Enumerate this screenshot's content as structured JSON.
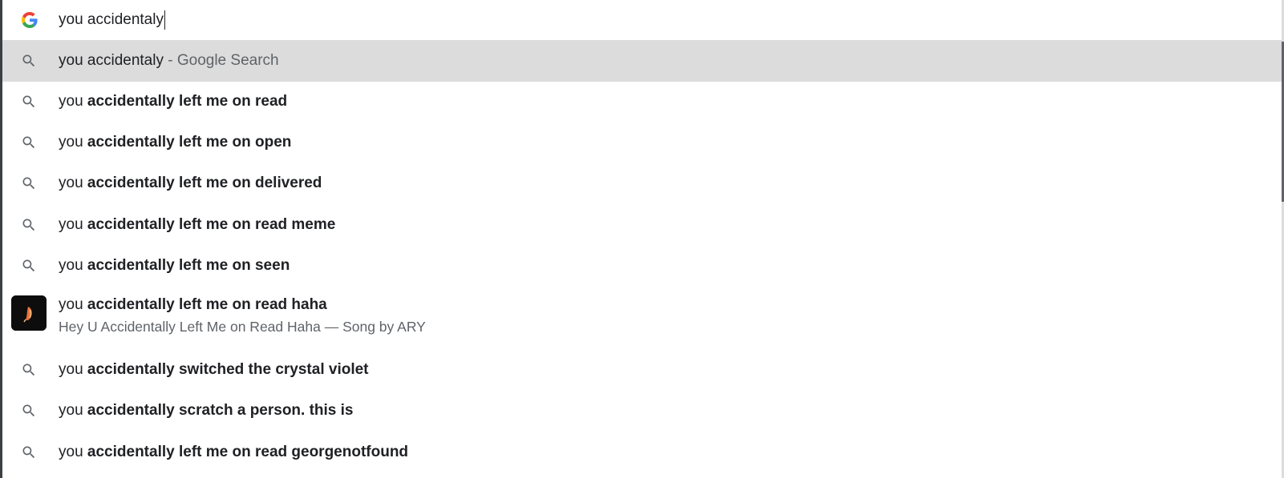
{
  "omnibox": {
    "query": "you accidentaly",
    "engine_icon": "google-g-icon"
  },
  "suggestions": [
    {
      "prefix": "you accidentaly",
      "bold": "",
      "sep": " - ",
      "tail": "Google Search",
      "icon": "search-icon",
      "selected": true
    },
    {
      "prefix": "you ",
      "bold": "accidentally left me on read",
      "icon": "search-icon"
    },
    {
      "prefix": "you ",
      "bold": "accidentally left me on open",
      "icon": "search-icon"
    },
    {
      "prefix": "you ",
      "bold": "accidentally left me on delivered",
      "icon": "search-icon"
    },
    {
      "prefix": "you ",
      "bold": "accidentally left me on read meme",
      "icon": "search-icon"
    },
    {
      "prefix": "you ",
      "bold": "accidentally left me on seen",
      "icon": "search-icon"
    },
    {
      "prefix": "you ",
      "bold": "accidentally left me on read haha",
      "subtitle": "Hey U Accidentally Left Me on Read Haha — Song by ARY",
      "icon": "album-art-thumbnail"
    },
    {
      "prefix": "you ",
      "bold": "accidentally switched the crystal violet",
      "icon": "search-icon"
    },
    {
      "prefix": "you ",
      "bold": "accidentally scratch a person. this is",
      "icon": "search-icon"
    },
    {
      "prefix": "you ",
      "bold": "accidentally left me on read georgenotfound",
      "icon": "search-icon"
    }
  ],
  "colors": {
    "selected_row": "#dcdcdc",
    "secondary_text": "#5f6368",
    "primary_text": "#202124"
  }
}
